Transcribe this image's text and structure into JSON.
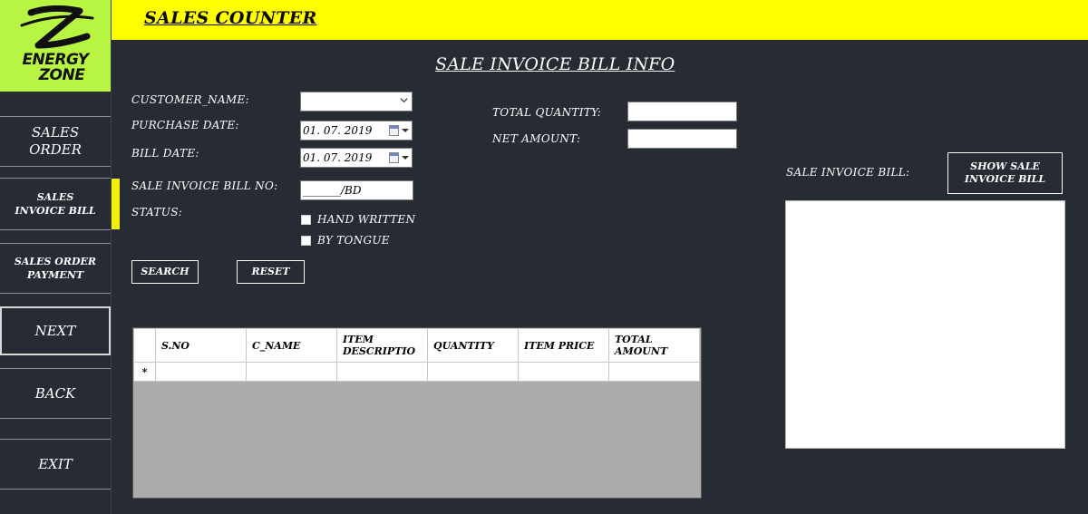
{
  "header": {
    "title": "SALES COUNTER"
  },
  "logo": {
    "line1": "ENERGY",
    "line2": "ZONE",
    "icon": "z-swoosh-logo",
    "bg": "#b7f542"
  },
  "sidebar": {
    "items": [
      {
        "label1": "SALES",
        "label2": "ORDER"
      },
      {
        "label1": "SALES",
        "label2": "INVOICE BILL",
        "active": true
      },
      {
        "label1": "SALES ORDER",
        "label2": "PAYMENT"
      },
      {
        "label1": "NEXT"
      },
      {
        "label1": "BACK"
      },
      {
        "label1": "EXIT"
      }
    ]
  },
  "page": {
    "title": "SALE INVOICE BILL INFO"
  },
  "form": {
    "customer_label": "CUSTOMER_NAME:",
    "customer_value": "",
    "purchase_label": "PURCHASE DATE:",
    "purchase_value": "01. 07. 2019",
    "bill_date_label": "BILL DATE:",
    "bill_date_value": "01. 07. 2019",
    "bill_no_label": "SALE INVOICE BILL NO:",
    "bill_no_value": "_______/BD",
    "status_label": "STATUS:",
    "status_options": [
      "HAND WRITTEN",
      "BY TONGUE"
    ],
    "total_qty_label": "TOTAL QUANTITY:",
    "total_qty_value": "",
    "net_amount_label": "NET AMOUNT:",
    "net_amount_value": ""
  },
  "buttons": {
    "search": "SEARCH",
    "reset": "RESET",
    "show_line1": "SHOW SALE",
    "show_line2": "INVOICE BILL"
  },
  "invoice_panel": {
    "label": "SALE INVOICE BILL:"
  },
  "grid": {
    "columns": [
      {
        "l1": "S.NO"
      },
      {
        "l1": "C_NAME"
      },
      {
        "l1": "ITEM",
        "l2": "DESCRIPTIO"
      },
      {
        "l1": "QUANTITY"
      },
      {
        "l1": "ITEM PRICE"
      },
      {
        "l1": "TOTAL",
        "l2": "AMOUNT"
      }
    ],
    "new_row_marker": "*"
  },
  "colors": {
    "accent": "#ffff00",
    "background": "#272b33",
    "grid_empty": "#ababab"
  }
}
